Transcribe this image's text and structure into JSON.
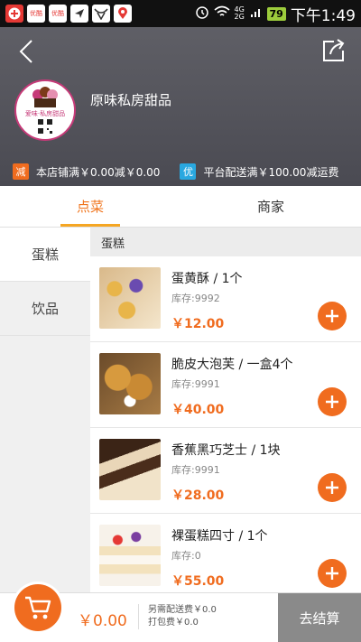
{
  "status_bar": {
    "apps": [
      {
        "icon": "plus-icon",
        "text": "",
        "color": "#e53935"
      },
      {
        "icon": "youku-icon",
        "text": "优酷",
        "color": "#e53935"
      },
      {
        "icon": "youku-icon",
        "text": "优酷",
        "color": "#e53935"
      },
      {
        "icon": "navigation-icon",
        "text": "",
        "color": "#333"
      },
      {
        "icon": "bull-icon",
        "text": "",
        "color": "#333"
      },
      {
        "icon": "map-pin-icon",
        "text": "",
        "color": "#e53935"
      }
    ],
    "network": "4G 2G",
    "battery": "79",
    "time": "下午1:49"
  },
  "header": {
    "shop_name": "原味私房甜品",
    "logo_text": "爱味·私房甜品",
    "promos": [
      {
        "badge": "减",
        "badge_color": "#f06c1f",
        "text": "本店铺满￥0.00减￥0.00"
      },
      {
        "badge": "优",
        "badge_color": "#29a8e0",
        "text": "平台配送满￥100.00减运费"
      }
    ]
  },
  "tabs": [
    {
      "label": "点菜",
      "active": true
    },
    {
      "label": "商家",
      "active": false
    }
  ],
  "categories": [
    {
      "label": "蛋糕",
      "active": true
    },
    {
      "label": "饮品",
      "active": false
    }
  ],
  "product_section": "蛋糕",
  "products": [
    {
      "name": "蛋黄酥 / 1个",
      "stock": "库存:9992",
      "price": "￥12.00"
    },
    {
      "name": "脆皮大泡芙 / 一盒4个",
      "stock": "库存:9991",
      "price": "￥40.00"
    },
    {
      "name": "香蕉黑巧芝士 / 1块",
      "stock": "库存:9991",
      "price": "￥28.00"
    },
    {
      "name": "裸蛋糕四寸 / 1个",
      "stock": "库存:0",
      "price": "￥55.00"
    }
  ],
  "bottom_bar": {
    "total": "￥0.00",
    "delivery_fee": "另需配送费￥0.0",
    "packing_fee": "打包费￥0.0",
    "checkout_label": "去结算"
  },
  "colors": {
    "accent": "#f06c1f",
    "header_bg": "#55555d",
    "checkout_bg": "#8a8a8a"
  }
}
